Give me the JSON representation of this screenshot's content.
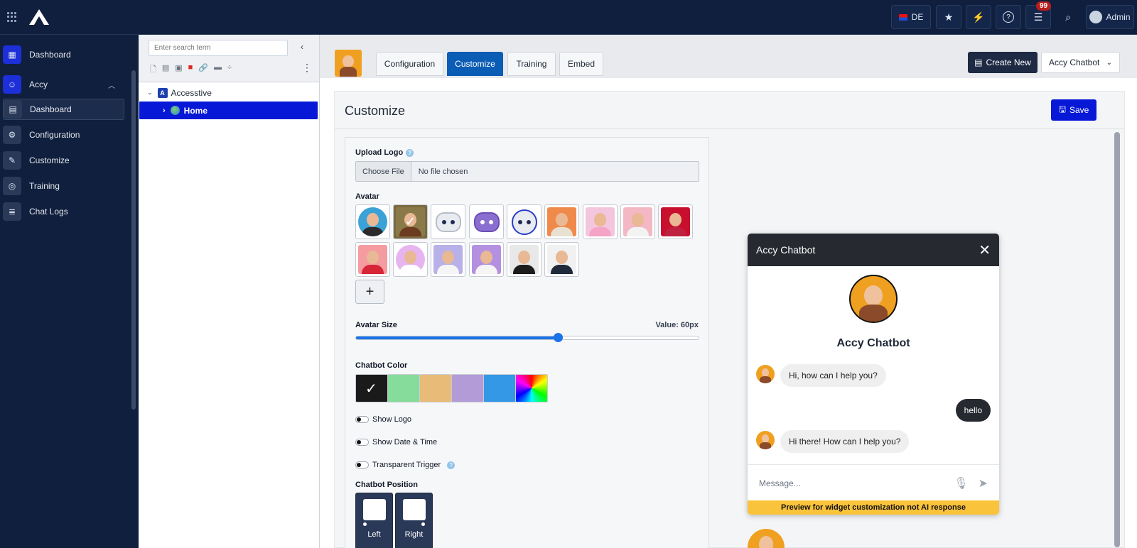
{
  "topbar": {
    "lang": "DE",
    "notification_count": "99",
    "user": "Admin"
  },
  "sidebar": {
    "items": [
      {
        "label": "Dashboard"
      },
      {
        "label": "Accy"
      },
      {
        "label": "Dashboard"
      },
      {
        "label": "Configuration"
      },
      {
        "label": "Customize"
      },
      {
        "label": "Training"
      },
      {
        "label": "Chat Logs"
      }
    ]
  },
  "tree": {
    "search_placeholder": "Enter search term",
    "nodes": [
      {
        "label": "Accesstive"
      },
      {
        "label": "Home"
      }
    ]
  },
  "header": {
    "tabs": [
      "Configuration",
      "Customize",
      "Training",
      "Embed"
    ],
    "active_tab": "Customize",
    "create_label": "Create New",
    "bot_select": "Accy Chatbot"
  },
  "customize": {
    "title": "Customize",
    "save_label": "Save",
    "upload_logo_label": "Upload Logo",
    "choose_file": "Choose File",
    "no_file": "No file chosen",
    "avatar_label": "Avatar",
    "avatar_size_label": "Avatar Size",
    "avatar_size_value": "Value: 60px",
    "avatar_size_fraction": 0.59,
    "chatbot_color_label": "Chatbot Color",
    "colors": [
      "#1a1a1a",
      "#86dc9a",
      "#e9bb78",
      "#b39bd8",
      "#3498e6",
      "rainbow"
    ],
    "selected_color": "#1a1a1a",
    "toggles": [
      {
        "label": "Show Logo"
      },
      {
        "label": "Show Date & Time"
      },
      {
        "label": "Transparent Trigger"
      }
    ],
    "position_label": "Chatbot Position",
    "positions": [
      "Left",
      "Right"
    ]
  },
  "chat": {
    "header_title": "Accy Chatbot",
    "bot_name": "Accy Chatbot",
    "messages": [
      {
        "from": "bot",
        "text": "Hi, how can I help you?"
      },
      {
        "from": "user",
        "text": "hello"
      },
      {
        "from": "bot",
        "text": "Hi there! How can I help you?"
      }
    ],
    "input_placeholder": "Message...",
    "preview_note": "Preview for widget customization not AI response"
  }
}
